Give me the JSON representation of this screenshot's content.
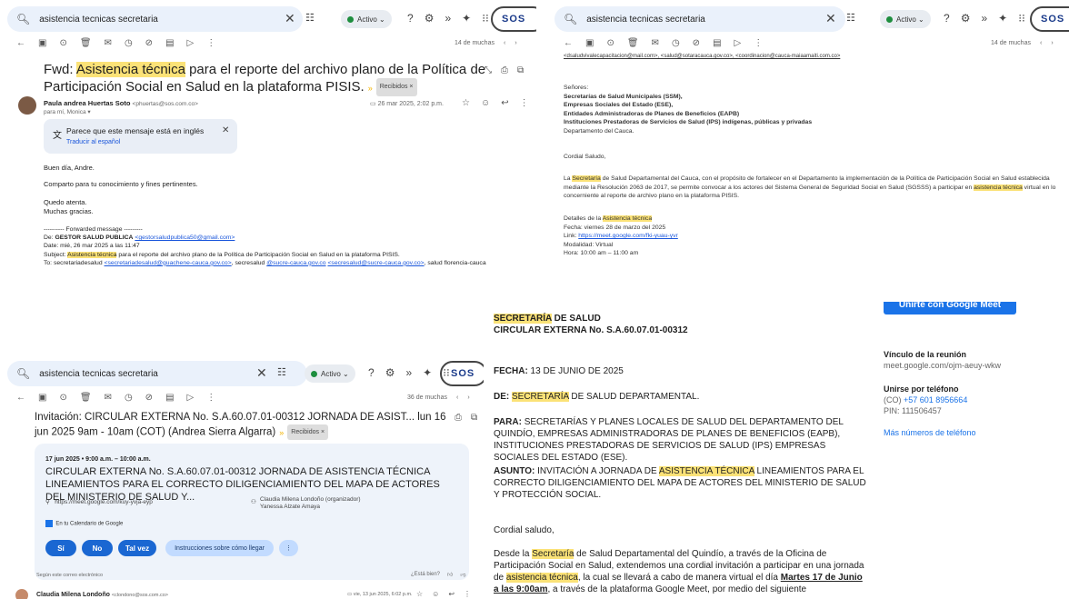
{
  "search": {
    "query": "asistencia tecnicas secretaria",
    "status": "Activo"
  },
  "brand": "SOS",
  "panel1": {
    "pager": "14 de muchas",
    "subject_prefix": "Fwd: ",
    "subject_hl": "Asistencia técnica",
    "subject_rest": " para el reporte del archivo plano de la Política de Participación Social en Salud en la plataforma PISIS.",
    "label": "Recibidos",
    "sender_name": "Paula andrea Huertas Soto",
    "sender_email": "<phuertas@sos.com.co>",
    "to_line": "para mí, Monica",
    "date": "26 mar 2025, 2:02 p.m.",
    "translate_msg": "Parece que este mensaje está en inglés",
    "translate_link": "Traducir al español",
    "body": [
      "Buen día, Andre.",
      "Comparto para tu conocimiento y fines pertinentes.",
      "Quedo atenta.",
      "Muchas gracias."
    ],
    "fwd_header": "---------- Forwarded message ---------",
    "fwd_from_label": "De: ",
    "fwd_from_name": "GESTOR SALUD PUBLICA",
    "fwd_from_email": "<gestorsaludpublica50@gmail.com>",
    "fwd_date": "Date: mié, 26 mar 2025 a las 11:47",
    "fwd_subject_label": "Subject: ",
    "fwd_subject_hl": "Asistencia técnica",
    "fwd_subject_rest": " para el reporte del archivo plano de la Política de Participación Social en Salud en la plataforma PISIS.",
    "fwd_to_a": "To: secretariadesalud ",
    "fwd_to_link1": "<secretariadesalud@guachene-cauca.gov.co>",
    "fwd_to_b": ", secresalud ",
    "fwd_to_link2": "@sucre-cauca.gov.co",
    "fwd_to_c": " ",
    "fwd_to_link3": "<secresalud@sucre-cauca.gov.co>",
    "fwd_to_d": ", salud florencia-cauca"
  },
  "panel2": {
    "pager": "14 de muchas",
    "top_line": "<dsaludvivalecapacitacion@mail.com>, <salud@sotaracauca.gov.co>, <coordinacion@cauca-maiaamaiti.com.co>",
    "greeting_list": [
      "Señores:",
      "Secretarías de Salud Municipales (SSM),",
      "Empresas Sociales del Estado (ESE),",
      "Entidades Administradoras de Planes de Beneficios (EAPB)",
      "Instituciones Prestadoras de Servicios de Salud (IPS) indígenas, públicas y privadas",
      "Departamento del Cauca."
    ],
    "salute": "Cordial Saludo,",
    "para_a": "La ",
    "para_hl1": "Secretaría",
    "para_b": " de Salud Departamental del Cauca, con el propósito de fortalecer en el Departamento la implementación de la Política de Participación Social en Salud establecida mediante la Resolución 2063 de 2017, se permite convocar a los actores del Sistema General de Seguridad Social en Salud (SGSSS) a participar en ",
    "para_hl2": "asistencia técnica",
    "para_c": " virtual en lo concerniente al reporte de archivo plano en la plataforma PISIS.",
    "details_label": "Detalles de la ",
    "details_hl": "Asistencia técnica",
    "fecha": "Fecha: viernes 28 de marzo del 2025",
    "link_label": "Link: ",
    "link": "https://meet.google.com/fki-yuau-yvr",
    "modalidad": "Modalidad: Virtual",
    "hora": "Hora: 10:00 am – 11:00 am"
  },
  "panel3": {
    "pager": "36 de muchas",
    "subject": "Invitación: CIRCULAR EXTERNA No. S.A.60.07.01-00312 JORNADA DE ASIST... lun 16 jun 2025 9am - 10am (COT) (Andrea Sierra Algarra)",
    "label": "Recibidos",
    "event_time": "17 jun 2025 • 9:00 a.m. – 10:00 a.m.",
    "event_title": "CIRCULAR EXTERNA No. S.A.60.07.01-00312 JORNADA DE ASISTENCIA TÉCNICA LINEAMIENTOS PARA EL CORRECTO DILIGENCIAMIENTO DEL MAPA DE ACTORES DEL MINISTERIO DE SALUD Y...",
    "meet_link": "https://meet.google.com/kuy-yvja-eyp",
    "organizer": "Claudia Milena Londoño (organizador)",
    "guest": "Yanessa Alzate Amaya",
    "calendar": "En tu Calendario de Google",
    "btn_yes": "Sí",
    "btn_no": "No",
    "btn_maybe": "Tal vez",
    "btn_directions": "Instrucciones sobre cómo llegar",
    "by_email": "Según este correo electrónico",
    "feedback": "¿Está bien?",
    "sender": "Claudia Milena Londoño",
    "sender_email": "<clondono@sos.com.co>",
    "date": "vie, 13 jun 2025, 6:02 p.m."
  },
  "panel4": {
    "meet_btn": "Unirte con Google Meet",
    "header_hl": "SECRETARÍA",
    "header_rest": " DE SALUD",
    "circular": "CIRCULAR EXTERNA No. S.A.60.07.01-00312",
    "fecha_label": "FECHA:",
    "fecha": " 13 DE JUNIO DE 2025",
    "de_label": "DE: ",
    "de_hl": "SECRETARÍA",
    "de_rest": " DE SALUD DEPARTAMENTAL.",
    "para_label": "PARA:",
    "para": " SECRETARÍAS Y PLANES LOCALES DE SALUD DEL DEPARTAMENTO DEL QUINDÍO, EMPRESAS ADMINISTRADORAS DE PLANES DE BENEFICIOS (EAPB), INSTITUCIONES PRESTADORAS DE SERVICIOS DE SALUD (IPS) EMPRESAS SOCIALES DEL ESTADO (ESE).",
    "asunto_label": "ASUNTO:",
    "asunto_a": " INVITACIÓN A JORNADA DE ",
    "asunto_hl": "ASISTENCIA TÉCNICA",
    "asunto_b": " LINEAMIENTOS PARA EL CORRECTO DILIGENCIAMIENTO DEL MAPA DE ACTORES DEL MINISTERIO DE SALUD Y PROTECCIÓN SOCIAL.",
    "saludo": "Cordial saludo,",
    "body_a": "Desde la ",
    "body_hl1": "Secretaría",
    "body_b": " de Salud Departamental del Quindío, a través de la Oficina de Participación Social en Salud, extendemos una cordial invitación a participar en una jornada de ",
    "body_hl2": "asistencia técnica",
    "body_c": ", la cual se llevará a cabo de manera virtual el día ",
    "body_date": "Martes 17 de Junio a las 9:00am",
    "body_d": ", a través de la plataforma Google Meet, por medio del siguiente",
    "side_link_title": "Vínculo de la reunión",
    "side_link": "meet.google.com/ojm-aeuy-wkw",
    "side_phone_title": "Unirse por teléfono",
    "side_phone": "(CO) +57 601 8956664",
    "side_pin": "PIN: 111506457",
    "side_more": "Más números de teléfono"
  }
}
